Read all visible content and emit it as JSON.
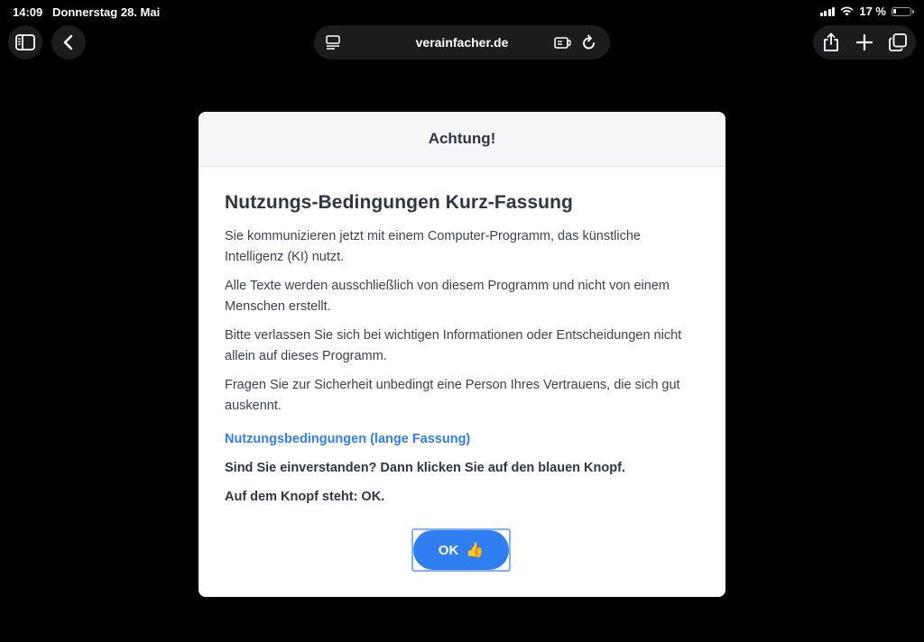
{
  "status_bar": {
    "time": "14:09",
    "date": "Donnerstag 28. Mai",
    "battery": "17 %",
    "battery_level": 0.17
  },
  "browser": {
    "url": "verainfacher.de",
    "icons": [
      "sidebar-icon",
      "back-icon",
      "page-menu-icon",
      "extension-icon",
      "reload-icon",
      "share-icon",
      "plus-icon",
      "tabs-icon"
    ]
  },
  "modal": {
    "header": "Achtung!",
    "title": "Nutzungs-Bedingungen Kurz-Fassung",
    "paragraphs": [
      "Sie kommunizieren jetzt mit einem Computer-Programm, das künstliche Intelligenz (KI) nutzt.",
      "Alle Texte werden ausschließlich von diesem Programm und nicht von einem Menschen erstellt.",
      "Bitte verlassen Sie sich bei wichtigen Informationen oder Entscheidungen nicht allein auf dieses Programm.",
      "Fragen Sie zur Sicherheit unbedingt eine Person Ihres Vertrauens, die sich gut auskennt."
    ],
    "link": "Nutzungsbedingungen (lange Fassung)",
    "question": "Sind Sie einverstanden? Dann klicken Sie auf den blauen Knopf.",
    "hint": "Auf dem Knopf steht: OK.",
    "ok_label": "OK",
    "ok_emoji": "👍"
  },
  "colors": {
    "accent": "#2f7ff0",
    "text": "#3b4251",
    "header_bg": "#f5f6f8"
  }
}
